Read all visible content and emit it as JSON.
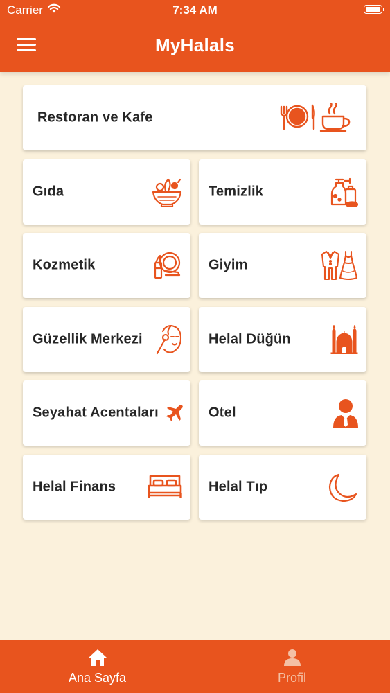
{
  "status_bar": {
    "carrier": "Carrier",
    "time": "7:34 AM",
    "wifi_icon": "wifi-icon",
    "battery_icon": "battery-icon"
  },
  "header": {
    "title": "MyHalals",
    "menu_icon": "hamburger-menu-icon"
  },
  "categories": [
    {
      "label": "Restoran ve Kafe",
      "icon": "restaurant-cafe-icon"
    },
    {
      "label": "Gıda",
      "icon": "salad-bowl-icon"
    },
    {
      "label": "Temizlik",
      "icon": "cleaning-supplies-icon"
    },
    {
      "label": "Kozmetik",
      "icon": "cosmetics-icon"
    },
    {
      "label": "Giyim",
      "icon": "clothing-icon"
    },
    {
      "label": "Güzellik Merkezi",
      "icon": "beauty-face-icon"
    },
    {
      "label": "Helal Düğün",
      "icon": "mosque-icon"
    },
    {
      "label": "Seyahat Acentaları",
      "icon": "airplane-icon"
    },
    {
      "label": "Otel",
      "icon": "businessman-icon"
    },
    {
      "label": "Helal Finans",
      "icon": "bed-icon"
    },
    {
      "label": "Helal Tıp",
      "icon": "crescent-moon-icon"
    }
  ],
  "tabs": [
    {
      "label": "Ana Sayfa",
      "icon": "home-icon",
      "active": true
    },
    {
      "label": "Profil",
      "icon": "user-icon",
      "active": false
    }
  ],
  "colors": {
    "brand": "#e8541e",
    "background": "#fbf1dc",
    "card": "#ffffff",
    "inactive_tab": "#f4c0a4"
  }
}
